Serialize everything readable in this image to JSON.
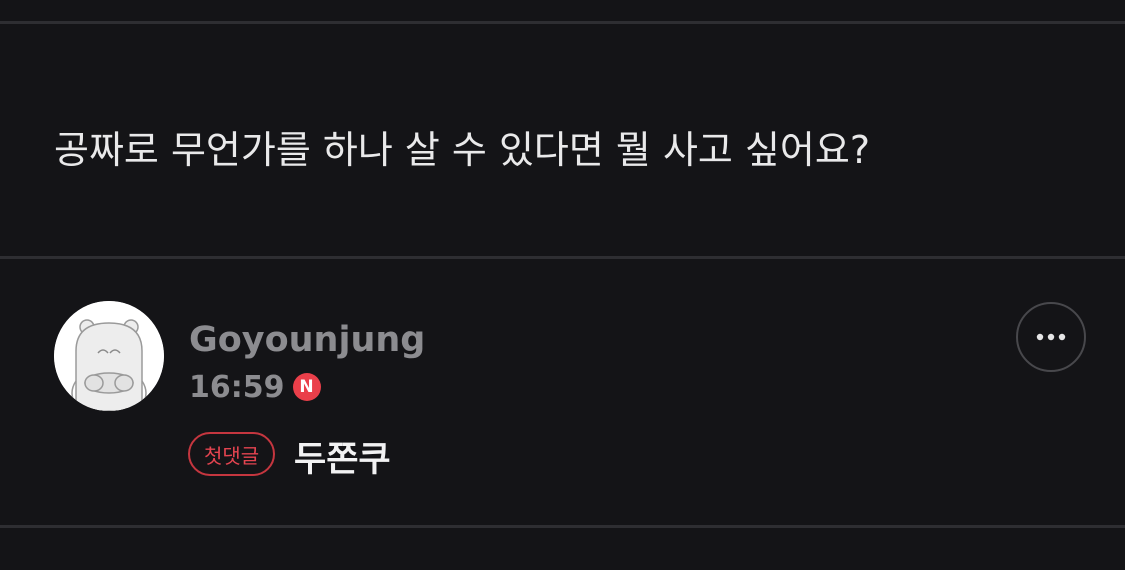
{
  "post": {
    "question": "공짜로 무언가를 하나 살 수 있다면 뭘 사고 싶어요?"
  },
  "comment": {
    "username": "Goyounjung",
    "time": "16:59",
    "new_badge": "N",
    "first_comment_label": "첫댓글",
    "text": "두쫀쿠",
    "avatar_icon": "bear-avatar-icon",
    "more_icon": "more-dots-icon"
  },
  "colors": {
    "background": "#141417",
    "divider": "#2e2e32",
    "accent_red": "#ea3f4a",
    "muted_text": "#8c8c90"
  }
}
